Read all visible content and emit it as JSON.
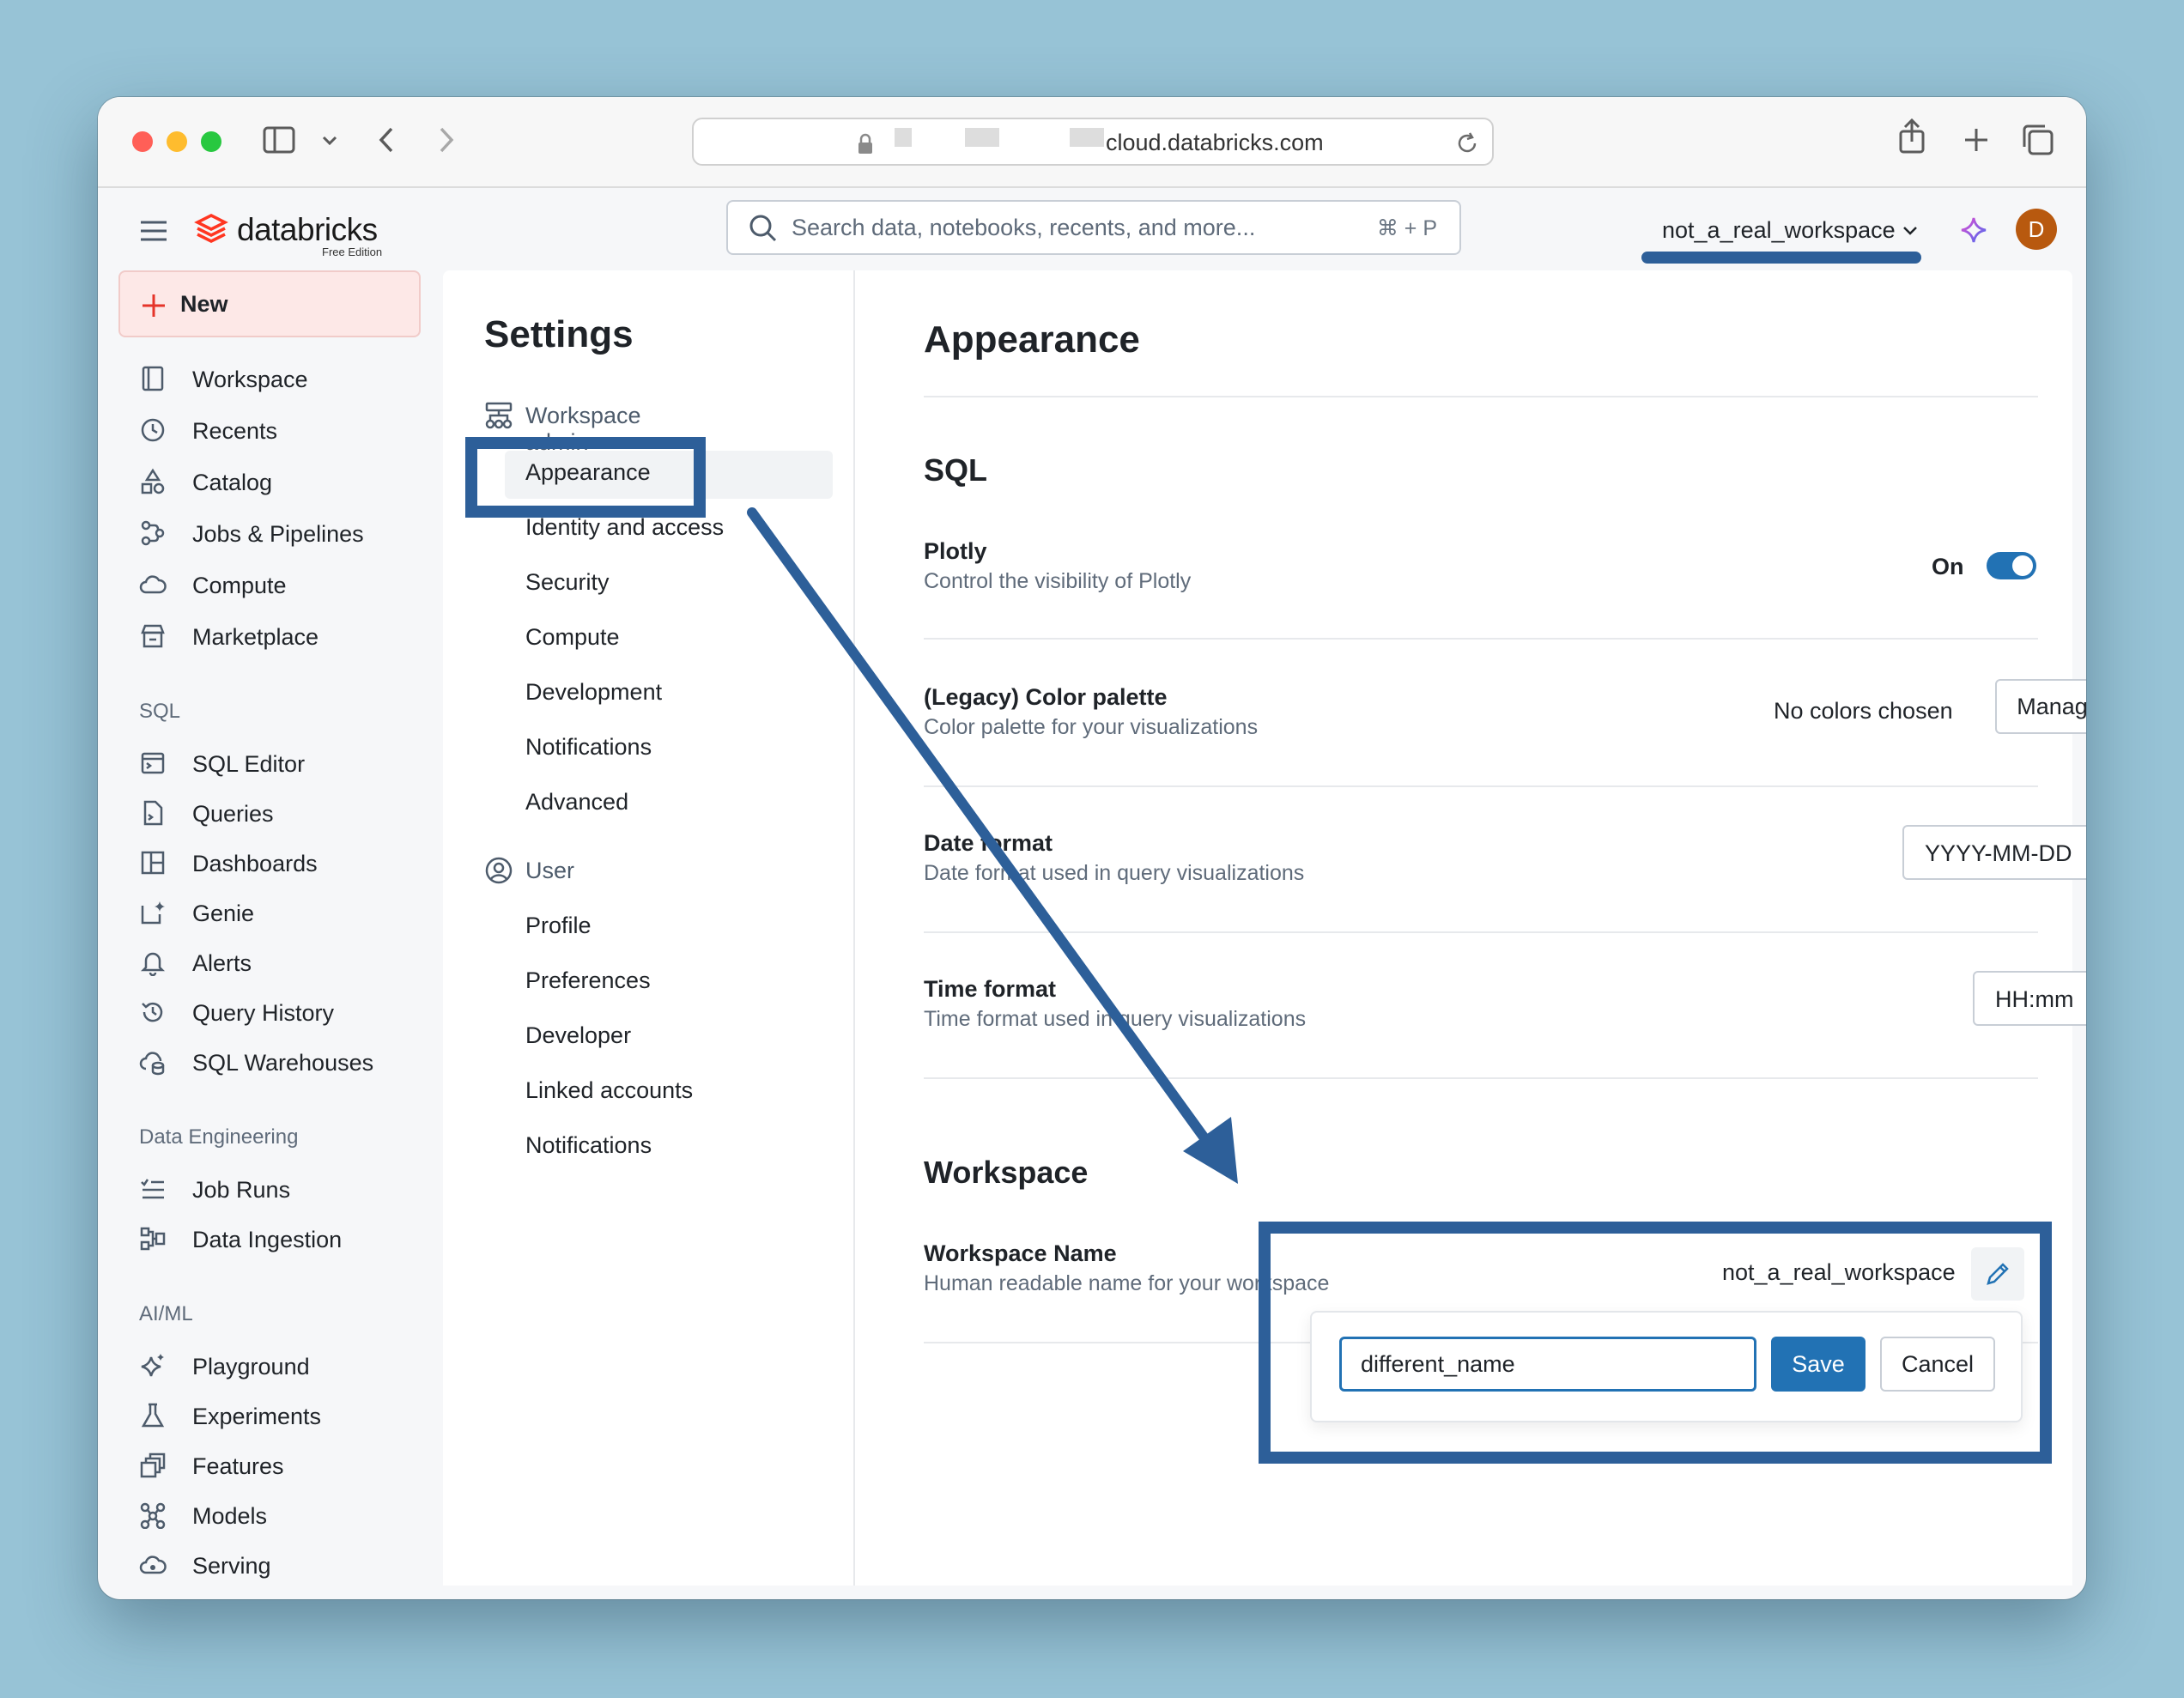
{
  "browser": {
    "url": "cloud.databricks.com"
  },
  "header": {
    "logo_text": "databricks",
    "logo_subtitle": "Free Edition",
    "search_placeholder": "Search data, notebooks, recents, and more...",
    "search_shortcut": "⌘ + P",
    "workspace_switcher": "not_a_real_workspace",
    "avatar_initial": "D"
  },
  "sidebar": {
    "new_label": "New",
    "items": [
      {
        "label": "Workspace",
        "icon": "workspace-icon"
      },
      {
        "label": "Recents",
        "icon": "clock-icon"
      },
      {
        "label": "Catalog",
        "icon": "catalog-icon"
      },
      {
        "label": "Jobs & Pipelines",
        "icon": "workflow-icon"
      },
      {
        "label": "Compute",
        "icon": "cloud-icon"
      },
      {
        "label": "Marketplace",
        "icon": "store-icon"
      }
    ],
    "groups": [
      {
        "title": "SQL",
        "items": [
          {
            "label": "SQL Editor",
            "icon": "sql-editor-icon"
          },
          {
            "label": "Queries",
            "icon": "query-file-icon"
          },
          {
            "label": "Dashboards",
            "icon": "dashboard-icon"
          },
          {
            "label": "Genie",
            "icon": "genie-icon"
          },
          {
            "label": "Alerts",
            "icon": "bell-icon"
          },
          {
            "label": "Query History",
            "icon": "history-icon"
          },
          {
            "label": "SQL Warehouses",
            "icon": "warehouse-icon"
          }
        ]
      },
      {
        "title": "Data Engineering",
        "items": [
          {
            "label": "Job Runs",
            "icon": "list-check-icon"
          },
          {
            "label": "Data Ingestion",
            "icon": "ingestion-icon"
          }
        ]
      },
      {
        "title": "AI/ML",
        "items": [
          {
            "label": "Playground",
            "icon": "sparkle-icon"
          },
          {
            "label": "Experiments",
            "icon": "flask-icon"
          },
          {
            "label": "Features",
            "icon": "features-icon"
          },
          {
            "label": "Models",
            "icon": "models-icon"
          },
          {
            "label": "Serving",
            "icon": "serving-icon"
          }
        ]
      }
    ]
  },
  "settings": {
    "title": "Settings",
    "groups": [
      {
        "title": "Workspace admin",
        "icon": "workspace-admin-icon",
        "items": [
          "Appearance",
          "Identity and access",
          "Security",
          "Compute",
          "Development",
          "Notifications",
          "Advanced"
        ]
      },
      {
        "title": "User",
        "icon": "user-circle-icon",
        "items": [
          "Profile",
          "Preferences",
          "Developer",
          "Linked accounts",
          "Notifications"
        ]
      }
    ],
    "active_item": "Appearance"
  },
  "appearance": {
    "title": "Appearance",
    "sql_section": "SQL",
    "plotly": {
      "title": "Plotly",
      "description": "Control the visibility of Plotly",
      "state_label": "On",
      "enabled": true
    },
    "color_palette": {
      "title": "(Legacy) Color palette",
      "description": "Color palette for your visualizations",
      "value": "No colors chosen",
      "button": "Manage"
    },
    "date_format": {
      "title": "Date format",
      "description": "Date format used in query visualizations",
      "value": "YYYY-MM-DD"
    },
    "time_format": {
      "title": "Time format",
      "description": "Time format used in query visualizations",
      "value": "HH:mm"
    },
    "workspace_section": "Workspace",
    "workspace_name": {
      "title": "Workspace Name",
      "description": "Human readable name for your workspace",
      "current_value": "not_a_real_workspace",
      "input_value": "different_name",
      "save_label": "Save",
      "cancel_label": "Cancel"
    }
  },
  "colors": {
    "accent": "#2272b4",
    "annotation": "#2d5f99",
    "new_button_bg": "#fde8e7",
    "avatar_bg": "#b8590f"
  }
}
